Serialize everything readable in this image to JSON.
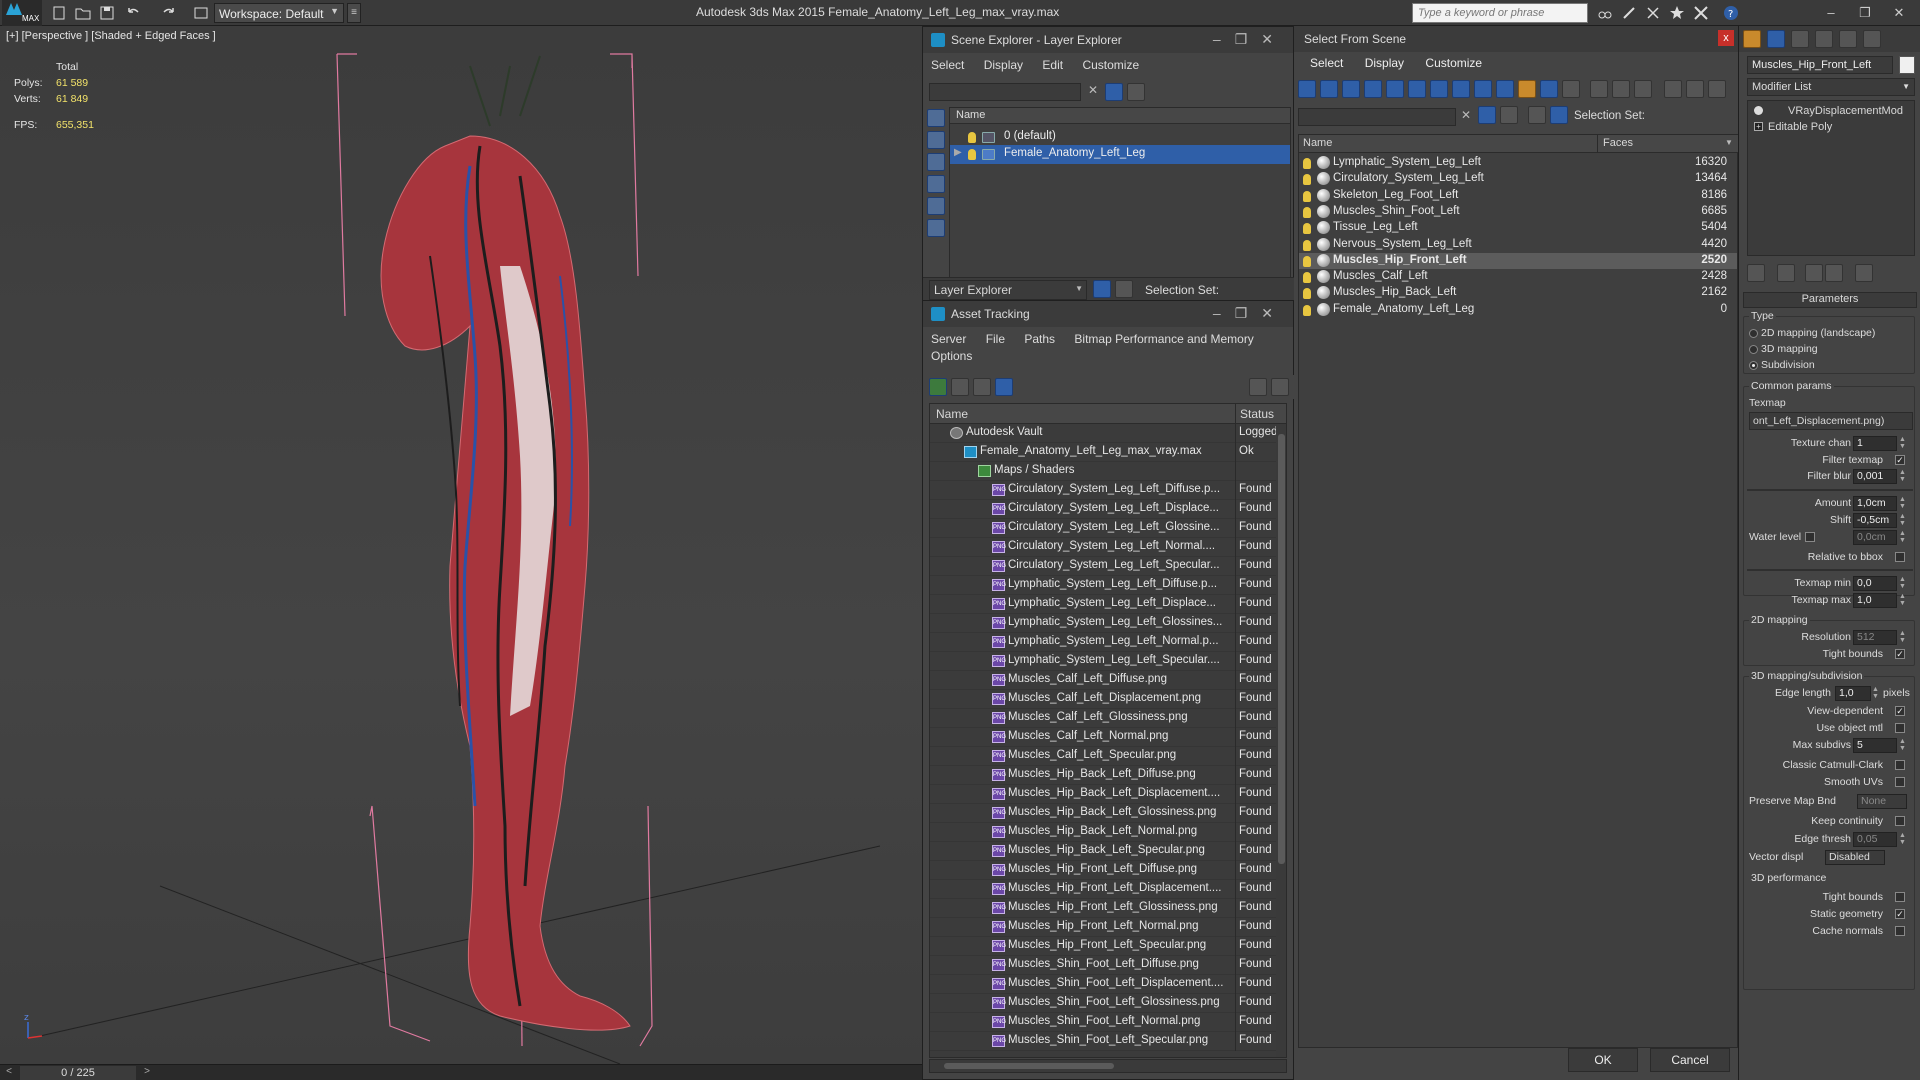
{
  "app": {
    "logo_text": "MAX",
    "title": "Autodesk 3ds Max  2015    Female_Anatomy_Left_Leg_max_vray.max",
    "workspace": "Workspace: Default",
    "search_placeholder": "Type a keyword or phrase"
  },
  "viewport": {
    "label": "[+] [Perspective ] [Shaded + Edged Faces ]",
    "stats": {
      "total_label": "Total",
      "polys_label": "Polys:",
      "polys_value": "61 589",
      "verts_label": "Verts:",
      "verts_value": "61 849",
      "fps_label": "FPS:",
      "fps_value": "655,351"
    }
  },
  "timeline": {
    "counter": "0 / 225",
    "prev": "<",
    "next": ">"
  },
  "scene_explorer": {
    "title": "Scene Explorer - Layer Explorer",
    "menu": [
      "Select",
      "Display",
      "Edit",
      "Customize"
    ],
    "column_name": "Name",
    "layers": [
      {
        "name": "0 (default)",
        "selected": false
      },
      {
        "name": "Female_Anatomy_Left_Leg",
        "selected": true
      }
    ],
    "footer_dropdown": "Layer Explorer",
    "footer_selection_set": "Selection Set:"
  },
  "asset_tracking": {
    "title": "Asset Tracking",
    "menu": [
      "Server",
      "File",
      "Paths",
      "Bitmap Performance and Memory"
    ],
    "menu2": [
      "Options"
    ],
    "col_name": "Name",
    "col_status": "Status",
    "rows": [
      {
        "name": "Autodesk Vault",
        "status": "Logged",
        "level": 0,
        "icon": "vault"
      },
      {
        "name": "Female_Anatomy_Left_Leg_max_vray.max",
        "status": "Ok",
        "level": 1,
        "icon": "max"
      },
      {
        "name": "Maps / Shaders",
        "status": "",
        "level": 2,
        "icon": "maps"
      },
      {
        "name": "Circulatory_System_Leg_Left_Diffuse.p...",
        "status": "Found",
        "level": 3,
        "icon": "png"
      },
      {
        "name": "Circulatory_System_Leg_Left_Displace...",
        "status": "Found",
        "level": 3,
        "icon": "png"
      },
      {
        "name": "Circulatory_System_Leg_Left_Glossine...",
        "status": "Found",
        "level": 3,
        "icon": "png"
      },
      {
        "name": "Circulatory_System_Leg_Left_Normal....",
        "status": "Found",
        "level": 3,
        "icon": "png"
      },
      {
        "name": "Circulatory_System_Leg_Left_Specular...",
        "status": "Found",
        "level": 3,
        "icon": "png"
      },
      {
        "name": "Lymphatic_System_Leg_Left_Diffuse.p...",
        "status": "Found",
        "level": 3,
        "icon": "png"
      },
      {
        "name": "Lymphatic_System_Leg_Left_Displace...",
        "status": "Found",
        "level": 3,
        "icon": "png"
      },
      {
        "name": "Lymphatic_System_Leg_Left_Glossines...",
        "status": "Found",
        "level": 3,
        "icon": "png"
      },
      {
        "name": "Lymphatic_System_Leg_Left_Normal.p...",
        "status": "Found",
        "level": 3,
        "icon": "png"
      },
      {
        "name": "Lymphatic_System_Leg_Left_Specular....",
        "status": "Found",
        "level": 3,
        "icon": "png"
      },
      {
        "name": "Muscles_Calf_Left_Diffuse.png",
        "status": "Found",
        "level": 3,
        "icon": "png"
      },
      {
        "name": "Muscles_Calf_Left_Displacement.png",
        "status": "Found",
        "level": 3,
        "icon": "png"
      },
      {
        "name": "Muscles_Calf_Left_Glossiness.png",
        "status": "Found",
        "level": 3,
        "icon": "png"
      },
      {
        "name": "Muscles_Calf_Left_Normal.png",
        "status": "Found",
        "level": 3,
        "icon": "png"
      },
      {
        "name": "Muscles_Calf_Left_Specular.png",
        "status": "Found",
        "level": 3,
        "icon": "png"
      },
      {
        "name": "Muscles_Hip_Back_Left_Diffuse.png",
        "status": "Found",
        "level": 3,
        "icon": "png"
      },
      {
        "name": "Muscles_Hip_Back_Left_Displacement....",
        "status": "Found",
        "level": 3,
        "icon": "png"
      },
      {
        "name": "Muscles_Hip_Back_Left_Glossiness.png",
        "status": "Found",
        "level": 3,
        "icon": "png"
      },
      {
        "name": "Muscles_Hip_Back_Left_Normal.png",
        "status": "Found",
        "level": 3,
        "icon": "png"
      },
      {
        "name": "Muscles_Hip_Back_Left_Specular.png",
        "status": "Found",
        "level": 3,
        "icon": "png"
      },
      {
        "name": "Muscles_Hip_Front_Left_Diffuse.png",
        "status": "Found",
        "level": 3,
        "icon": "png"
      },
      {
        "name": "Muscles_Hip_Front_Left_Displacement....",
        "status": "Found",
        "level": 3,
        "icon": "png"
      },
      {
        "name": "Muscles_Hip_Front_Left_Glossiness.png",
        "status": "Found",
        "level": 3,
        "icon": "png"
      },
      {
        "name": "Muscles_Hip_Front_Left_Normal.png",
        "status": "Found",
        "level": 3,
        "icon": "png"
      },
      {
        "name": "Muscles_Hip_Front_Left_Specular.png",
        "status": "Found",
        "level": 3,
        "icon": "png"
      },
      {
        "name": "Muscles_Shin_Foot_Left_Diffuse.png",
        "status": "Found",
        "level": 3,
        "icon": "png"
      },
      {
        "name": "Muscles_Shin_Foot_Left_Displacement....",
        "status": "Found",
        "level": 3,
        "icon": "png"
      },
      {
        "name": "Muscles_Shin_Foot_Left_Glossiness.png",
        "status": "Found",
        "level": 3,
        "icon": "png"
      },
      {
        "name": "Muscles_Shin_Foot_Left_Normal.png",
        "status": "Found",
        "level": 3,
        "icon": "png"
      },
      {
        "name": "Muscles_Shin_Foot_Left_Specular.png",
        "status": "Found",
        "level": 3,
        "icon": "png"
      }
    ]
  },
  "select_from_scene": {
    "title": "Select From Scene",
    "close": "x",
    "menu": [
      "Select",
      "Display",
      "Customize"
    ],
    "selection_set": "Selection Set:",
    "col_name": "Name",
    "col_faces": "Faces",
    "objects": [
      {
        "name": "Lymphatic_System_Leg_Left",
        "faces": "16320",
        "selected": false
      },
      {
        "name": "Circulatory_System_Leg_Left",
        "faces": "13464",
        "selected": false
      },
      {
        "name": "Skeleton_Leg_Foot_Left",
        "faces": "8186",
        "selected": false
      },
      {
        "name": "Muscles_Shin_Foot_Left",
        "faces": "6685",
        "selected": false
      },
      {
        "name": "Tissue_Leg_Left",
        "faces": "5404",
        "selected": false
      },
      {
        "name": "Nervous_System_Leg_Left",
        "faces": "4420",
        "selected": false
      },
      {
        "name": "Muscles_Hip_Front_Left",
        "faces": "2520",
        "selected": true
      },
      {
        "name": "Muscles_Calf_Left",
        "faces": "2428",
        "selected": false
      },
      {
        "name": "Muscles_Hip_Back_Left",
        "faces": "2162",
        "selected": false
      },
      {
        "name": "Female_Anatomy_Left_Leg",
        "faces": "0",
        "selected": false
      }
    ],
    "ok": "OK",
    "cancel": "Cancel"
  },
  "command_panel": {
    "object_name": "Muscles_Hip_Front_Left",
    "modifier_list": "Modifier List",
    "stack": [
      "VRayDisplacementMod",
      "Editable Poly"
    ],
    "rollout_title": "Parameters",
    "type_label": "Type",
    "type_options": [
      "2D mapping (landscape)",
      "3D mapping",
      "Subdivision"
    ],
    "type_selected_index": 2,
    "common_params": "Common params",
    "texmap_label": "Texmap",
    "texmap_value": "ont_Left_Displacement.png)",
    "texture_chan_label": "Texture chan",
    "texture_chan_value": "1",
    "filter_texmap_label": "Filter texmap",
    "filter_blur_label": "Filter blur",
    "filter_blur_value": "0,001",
    "amount_label": "Amount",
    "amount_value": "1,0cm",
    "shift_label": "Shift",
    "shift_value": "-0,5cm",
    "water_level_label": "Water level",
    "water_level_value": "0,0cm",
    "relative_bbox_label": "Relative to bbox",
    "texmap_min_label": "Texmap min",
    "texmap_min_value": "0,0",
    "texmap_max_label": "Texmap max",
    "texmap_max_value": "1,0",
    "mapping2d_title": "2D mapping",
    "resolution_label": "Resolution",
    "resolution_value": "512",
    "tight_bounds_label": "Tight bounds",
    "mapping3d_title": "3D mapping/subdivision",
    "edge_length_label": "Edge length",
    "edge_length_value": "1,0",
    "pixels_label": "pixels",
    "view_dependent_label": "View-dependent",
    "use_object_mtl_label": "Use object mtl",
    "max_subdivs_label": "Max subdivs",
    "max_subdivs_value": "5",
    "classic_catmull_label": "Classic Catmull-Clark",
    "smooth_uvs_label": "Smooth UVs",
    "preserve_map_label": "Preserve Map Bnd",
    "preserve_map_value": "None",
    "keep_continuity_label": "Keep continuity",
    "edge_thresh_label": "Edge thresh",
    "edge_thresh_value": "0,05",
    "vector_displ_label": "Vector displ",
    "vector_displ_value": "Disabled",
    "perf_title": "3D performance",
    "perf_tight_bounds_label": "Tight bounds",
    "static_geometry_label": "Static geometry",
    "cache_normals_label": "Cache normals"
  }
}
